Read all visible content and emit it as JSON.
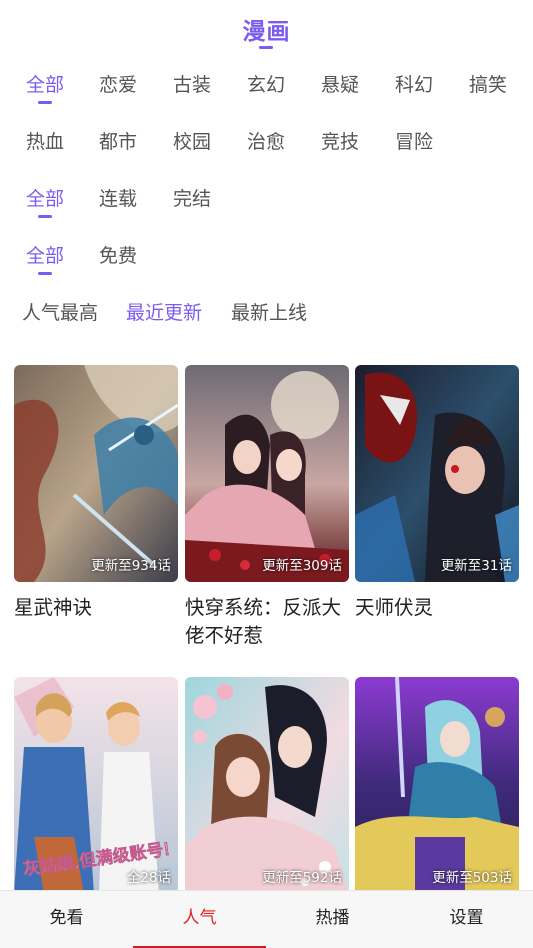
{
  "header": {
    "title": "漫画"
  },
  "genres": {
    "row1": [
      "全部",
      "恋爱",
      "古装",
      "玄幻",
      "悬疑",
      "科幻",
      "搞笑"
    ],
    "row2": [
      "热血",
      "都市",
      "校园",
      "治愈",
      "竞技",
      "冒险"
    ]
  },
  "status": [
    "全部",
    "连载",
    "完结"
  ],
  "price": [
    "全部",
    "免费"
  ],
  "sort": [
    "人气最高",
    "最近更新",
    "最新上线"
  ],
  "comics": [
    {
      "title": "星武神诀",
      "update": "更新至934话"
    },
    {
      "title": "快穿系统：反派大佬不好惹",
      "update": "更新至309话"
    },
    {
      "title": "天师伏灵",
      "update": "更新至31话"
    },
    {
      "title": "",
      "update": "全28话",
      "cover_text": "灰姑娘，但满级账号！"
    },
    {
      "title": "",
      "update": "更新至592话"
    },
    {
      "title": "",
      "update": "更新至503话"
    }
  ],
  "tabbar": [
    "免看",
    "人气",
    "热播",
    "设置"
  ],
  "colors": {
    "accent": "#7b5cf0",
    "tab_active": "#e02323"
  }
}
